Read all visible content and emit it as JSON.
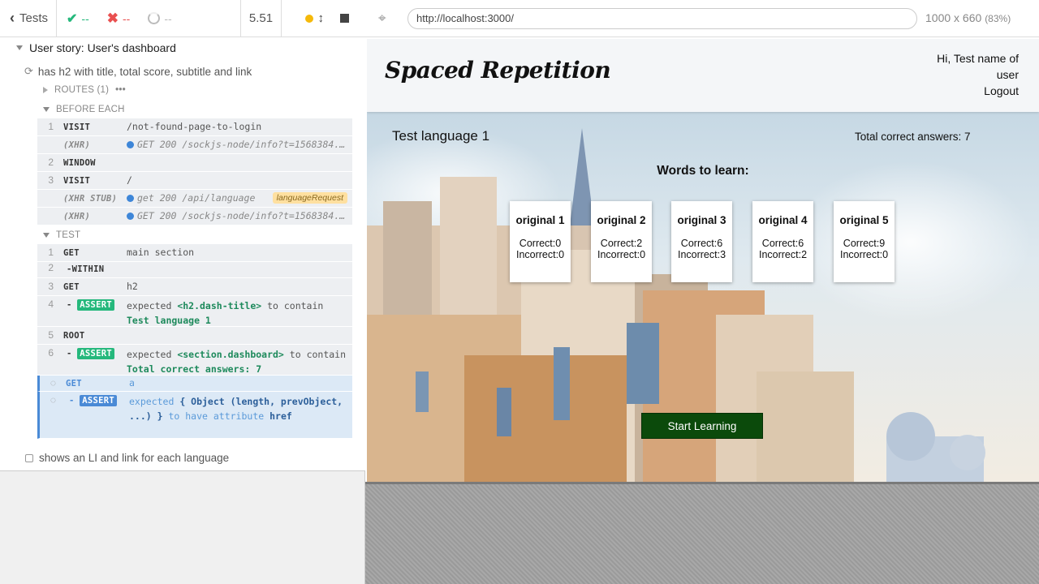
{
  "toolbar": {
    "tests_label": "Tests",
    "passed": "--",
    "failed": "--",
    "pending": "--",
    "duration": "5.51"
  },
  "suite": {
    "title": "User story: User's dashboard"
  },
  "test": {
    "title": "has h2 with title, total score, subtitle and link"
  },
  "routes": {
    "label": "ROUTES (1)"
  },
  "before_each": {
    "label": "BEFORE EACH",
    "commands": [
      {
        "num": "1",
        "name": "VISIT",
        "msg": "/not-found-page-to-login"
      },
      {
        "num": "",
        "name": "(XHR)",
        "msg": "GET 200 /sockjs-node/info?t=1568384..."
      },
      {
        "num": "2",
        "name": "WINDOW",
        "msg": ""
      },
      {
        "num": "3",
        "name": "VISIT",
        "msg": "/"
      },
      {
        "num": "",
        "name": "(XHR STUB)",
        "msg": "get 200 /api/language",
        "alias": "languageRequest"
      },
      {
        "num": "",
        "name": "(XHR)",
        "msg": "GET 200 /sockjs-node/info?t=1568384..."
      }
    ]
  },
  "test_block": {
    "label": "TEST",
    "commands": [
      {
        "num": "1",
        "name": "GET",
        "msg": "main section"
      },
      {
        "num": "2",
        "name": "-WITHIN",
        "msg": ""
      },
      {
        "num": "3",
        "name": "GET",
        "msg": "h2"
      },
      {
        "num": "4",
        "name": "-ASSERT",
        "pre": "expected ",
        "b1": "<h2.dash-title>",
        "mid": " to contain",
        "b2": "Test language 1"
      },
      {
        "num": "5",
        "name": "ROOT",
        "msg": ""
      },
      {
        "num": "6",
        "name": "-ASSERT",
        "pre": "expected ",
        "b1": "<section.dashboard>",
        "mid": " to contain ",
        "b2": "Total correct answers: 7"
      },
      {
        "num": "",
        "name": "GET",
        "msg": "a"
      },
      {
        "num": "",
        "name": "-ASSERT",
        "pre": "expected ",
        "b1": "{ Object (length, prevObject, ...) }",
        "mid": " to have attribute ",
        "b2": "href"
      }
    ]
  },
  "next_test": {
    "title": "shows an LI and link for each language"
  },
  "browser": {
    "url": "http://localhost:3000/",
    "viewport": "1000 x 660",
    "zoom": "(83%)"
  },
  "app": {
    "logo": "Spaced Repetition",
    "greeting": "Hi, Test name of user",
    "logout": "Logout",
    "language_title": "Test language 1",
    "total_score": "Total correct answers: 7",
    "words_heading": "Words to learn:",
    "words": [
      {
        "word": "original 1",
        "correct": "Correct:0",
        "incorrect": "Incorrect:0"
      },
      {
        "word": "original 2",
        "correct": "Correct:2",
        "incorrect": "Incorrect:0"
      },
      {
        "word": "original 3",
        "correct": "Correct:6",
        "incorrect": "Incorrect:3"
      },
      {
        "word": "original 4",
        "correct": "Correct:6",
        "incorrect": "Incorrect:2"
      },
      {
        "word": "original 5",
        "correct": "Correct:9",
        "incorrect": "Incorrect:0"
      }
    ],
    "start_button": "Start Learning"
  },
  "colors": {
    "pass": "#25b87c",
    "fail": "#e94f4f",
    "pending_blue": "#4a8ad6",
    "start_button": "#0b4a0b"
  }
}
